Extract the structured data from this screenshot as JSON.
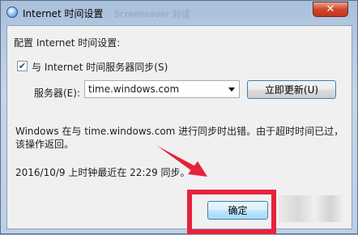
{
  "window": {
    "title": "Internet 时间设置",
    "background_title": "Screensaver 对话",
    "close_label": "✕"
  },
  "settings": {
    "group_label": "配置 Internet 时间设置:",
    "sync_checkbox_label": "与 Internet 时间服务器同步(S)",
    "sync_checked": true,
    "server_label": "服务器(E):",
    "server_value": "time.windows.com",
    "update_button": "立即更新(U)"
  },
  "status": {
    "error_line1": "Windows 在与 time.windows.com 进行同步时出错。由于超时时间已过，",
    "error_line2": "该操作返回。",
    "last_sync": "2016/10/9 上时钟最近在 22:29 同步。"
  },
  "buttons": {
    "ok": "确定"
  },
  "annotation": {
    "color": "#e5233b"
  }
}
